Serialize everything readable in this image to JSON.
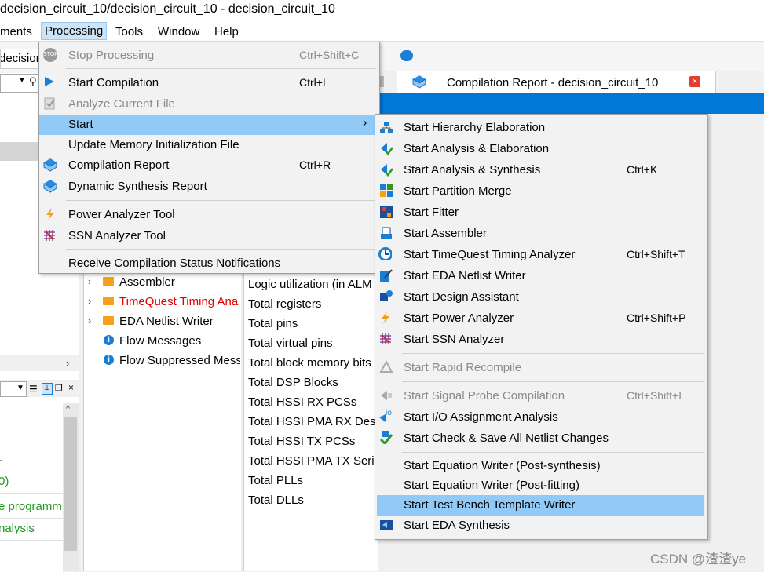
{
  "window": {
    "title": "decision_circuit_10/decision_circuit_10 - decision_circuit_10"
  },
  "menubar": [
    "ments",
    "Processing",
    "Tools",
    "Window",
    "Help"
  ],
  "toolbar": {
    "project_tab": "decision_c"
  },
  "report_tab": {
    "label": "Compilation Report - decision_circuit_10",
    "close": "×"
  },
  "processing_menu": {
    "items": [
      {
        "label": "Stop Processing",
        "shortcut": "Ctrl+Shift+C",
        "icon": "stop-icon",
        "disabled": true
      },
      {
        "label": "Start Compilation",
        "shortcut": "Ctrl+L",
        "icon": "play-icon"
      },
      {
        "label": "Analyze Current File",
        "shortcut": "",
        "icon": "analyze-file-icon",
        "disabled": true
      },
      {
        "label": "Start",
        "shortcut": "",
        "arrow": "›"
      },
      {
        "label": "Update Memory Initialization File",
        "shortcut": ""
      },
      {
        "label": "Compilation Report",
        "shortcut": "Ctrl+R",
        "icon": "report-icon"
      },
      {
        "label": "Dynamic Synthesis Report",
        "shortcut": "",
        "icon": "report-icon"
      },
      {
        "label": "Power Analyzer Tool",
        "shortcut": "",
        "icon": "lightning-icon"
      },
      {
        "label": "SSN Analyzer Tool",
        "shortcut": "",
        "icon": "ssn-grid-icon"
      },
      {
        "label": "Receive Compilation Status Notifications",
        "shortcut": ""
      }
    ]
  },
  "start_submenu": {
    "items": [
      {
        "label": "Start Hierarchy Elaboration",
        "shortcut": "",
        "icon": "hierarchy-icon"
      },
      {
        "label": "Start Analysis & Elaboration",
        "shortcut": "",
        "icon": "analysis-icon"
      },
      {
        "label": "Start Analysis & Synthesis",
        "shortcut": "Ctrl+K",
        "icon": "synthesis-icon"
      },
      {
        "label": "Start Partition Merge",
        "shortcut": "",
        "icon": "partition-icon"
      },
      {
        "label": "Start Fitter",
        "shortcut": "",
        "icon": "fitter-icon"
      },
      {
        "label": "Start Assembler",
        "shortcut": "",
        "icon": "assembler-icon"
      },
      {
        "label": "Start TimeQuest Timing Analyzer",
        "shortcut": "Ctrl+Shift+T",
        "icon": "timequest-icon"
      },
      {
        "label": "Start EDA Netlist Writer",
        "shortcut": "",
        "icon": "netlist-writer-icon"
      },
      {
        "label": "Start Design Assistant",
        "shortcut": "",
        "icon": "design-assistant-icon"
      },
      {
        "label": "Start Power Analyzer",
        "shortcut": "Ctrl+Shift+P",
        "icon": "lightning-icon"
      },
      {
        "label": "Start SSN Analyzer",
        "shortcut": "",
        "icon": "ssn-grid-icon"
      },
      {
        "label": "Start Rapid Recompile",
        "shortcut": "",
        "icon": "recompile-icon",
        "disabled": true
      },
      {
        "label": "Start Signal Probe Compilation",
        "shortcut": "Ctrl+Shift+I",
        "icon": "signal-probe-icon",
        "disabled": true
      },
      {
        "label": "Start I/O Assignment Analysis",
        "shortcut": "",
        "icon": "io-icon"
      },
      {
        "label": "Start Check & Save All Netlist Changes",
        "shortcut": "",
        "icon": "check-save-icon"
      },
      {
        "label": "Start Equation Writer (Post-synthesis)",
        "shortcut": ""
      },
      {
        "label": "Start Equation Writer (Post-fitting)",
        "shortcut": ""
      },
      {
        "label": "Start Test Bench Template Writer",
        "shortcut": "",
        "highlighted": true
      },
      {
        "label": "Start EDA Synthesis",
        "shortcut": "",
        "icon": "eda-synthesis-icon"
      }
    ]
  },
  "flow_tasks": [
    {
      "label": "Assembler",
      "type": "folder",
      "color": "#000000"
    },
    {
      "label": "TimeQuest Timing Ana",
      "type": "folder",
      "color": "#e00000"
    },
    {
      "label": "EDA Netlist Writer",
      "type": "folder",
      "color": "#000000"
    },
    {
      "label": "Flow Messages",
      "type": "info",
      "color": "#000000"
    },
    {
      "label": "Flow Suppressed Mess",
      "type": "info",
      "color": "#000000"
    }
  ],
  "summary_rows": [
    "Logic utilization (in ALM",
    "Total registers",
    "Total pins",
    "Total virtual pins",
    "Total block memory bits",
    "Total DSP Blocks",
    "Total HSSI RX PCSs",
    "Total HSSI PMA RX Des",
    "Total HSSI TX PCSs",
    "Total HSSI PMA TX Seri",
    "Total PLLs",
    "Total DLLs"
  ],
  "left_list": [
    {
      "text": "-",
      "color": "#1a9a1a"
    },
    {
      "text": "0)",
      "color": "#1a9a1a"
    },
    {
      "text": "e programm",
      "color": "#1a9a1a"
    },
    {
      "text": "nalysis",
      "color": "#1a9a1a"
    }
  ],
  "watermark": "CSDN @渣渣ye",
  "colors": {
    "menu_highlight": "#91c9f7",
    "blue_bar": "#0078d7",
    "folder": "#f7a11a",
    "error_red": "#e00000",
    "success_green": "#1a9a1a"
  }
}
